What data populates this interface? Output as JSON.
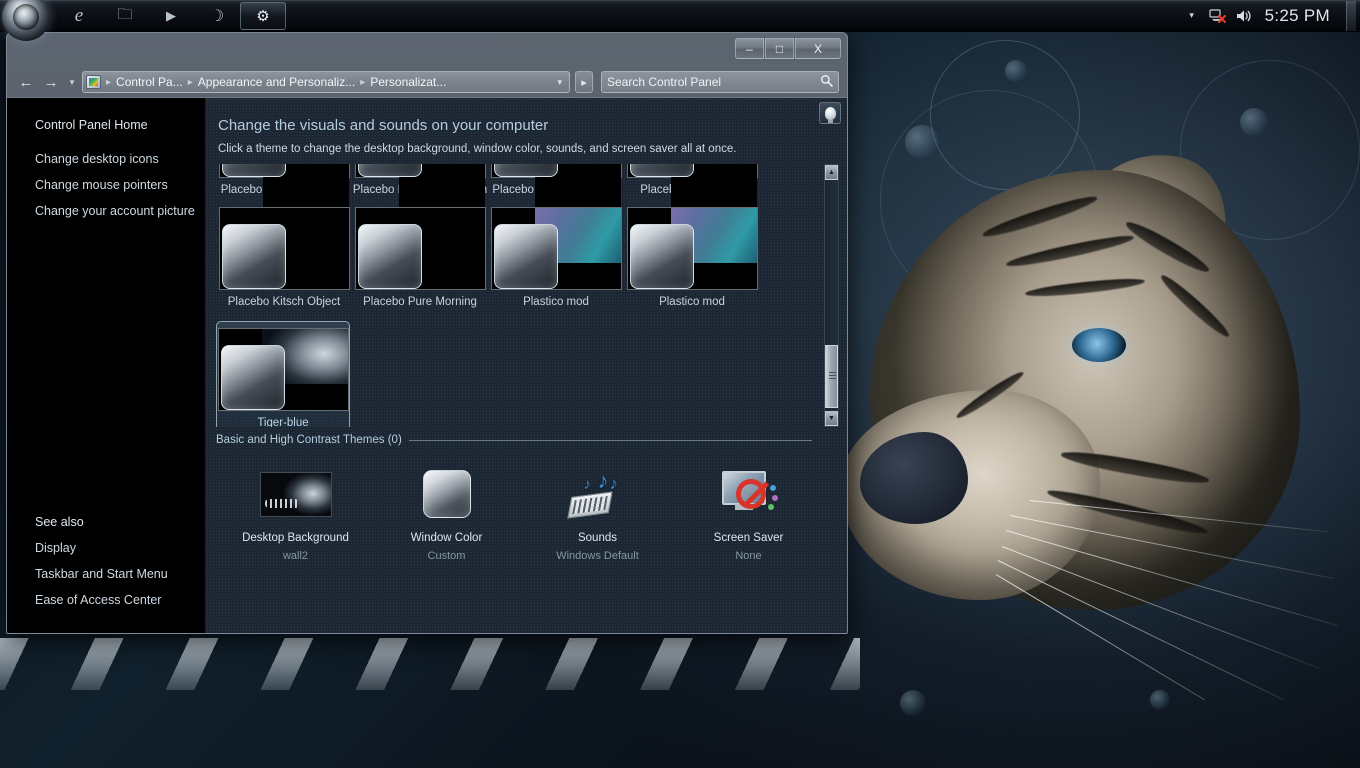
{
  "taskbar": {
    "start_orb": "windows-start-orb",
    "buttons": [
      {
        "name": "internet-explorer",
        "glyph": "e"
      },
      {
        "name": "windows-explorer",
        "glyph": "🗀"
      },
      {
        "name": "media-player",
        "glyph": "▶"
      },
      {
        "name": "firefox",
        "glyph": "☽"
      },
      {
        "name": "control-panel",
        "glyph": "⚙",
        "active": true
      }
    ],
    "tray": {
      "chevron": "▾",
      "network_icon": "network-disconnected",
      "volume_icon": "🔊",
      "clock": "5:25 PM"
    }
  },
  "window": {
    "controls": {
      "minimize": "–",
      "maximize": "□",
      "close": "X"
    },
    "nav": {
      "back": "←",
      "forward": "→",
      "history": "▾",
      "go": "▸"
    },
    "breadcrumb": [
      "Control Pa...",
      "Appearance and Personaliz...",
      "Personalizat..."
    ],
    "breadcrumb_separator": "▸",
    "search": {
      "placeholder": "Search Control Panel",
      "icon": "🔍"
    }
  },
  "sidebar": {
    "home": "Control Panel Home",
    "links": [
      "Change desktop icons",
      "Change mouse pointers",
      "Change your account picture"
    ],
    "see_also_title": "See also",
    "see_also": [
      "Display",
      "Taskbar and Start Menu",
      "Ease of Access Center"
    ]
  },
  "content": {
    "title": "Change the visuals and sounds on your computer",
    "subtitle": "Click a theme to change the desktop background, window color, sounds, and screen saver all at once.",
    "help_icon": "help-lightbulb",
    "basic_themes_label": "Basic and High Contrast Themes (0)",
    "themes_row1": [
      {
        "label": "Placebo Borderless Cold",
        "bg": "black"
      },
      {
        "label": "Placebo Borderless Kitsch",
        "bg": "black"
      },
      {
        "label": "Placebo Borderless Pure",
        "bg": "black"
      },
      {
        "label": "Placebo - Cold Light",
        "bg": "black"
      }
    ],
    "themes_row2": [
      {
        "label": "Placebo Kitsch Object",
        "bg": "black"
      },
      {
        "label": "Placebo Pure Morning",
        "bg": "black"
      },
      {
        "label": "Plastico mod",
        "bg": "plastico"
      },
      {
        "label": "Plastico mod",
        "bg": "plastico"
      }
    ],
    "themes_row3": [
      {
        "label": "Tiger-blue",
        "bg": "tiger",
        "selected": true
      }
    ]
  },
  "bottom_toolbar": [
    {
      "label": "Desktop Background",
      "value": "wall2",
      "icon": "wallpaper-icon"
    },
    {
      "label": "Window Color",
      "value": "Custom",
      "icon": "window-color-icon"
    },
    {
      "label": "Sounds",
      "value": "Windows Default",
      "icon": "sounds-icon"
    },
    {
      "label": "Screen Saver",
      "value": "None",
      "icon": "screensaver-icon"
    }
  ],
  "colors": {
    "accent": "#b6cde0",
    "content_bg": "#1c2733",
    "sidebar_bg": "#000000",
    "chrome": "#606a74"
  }
}
